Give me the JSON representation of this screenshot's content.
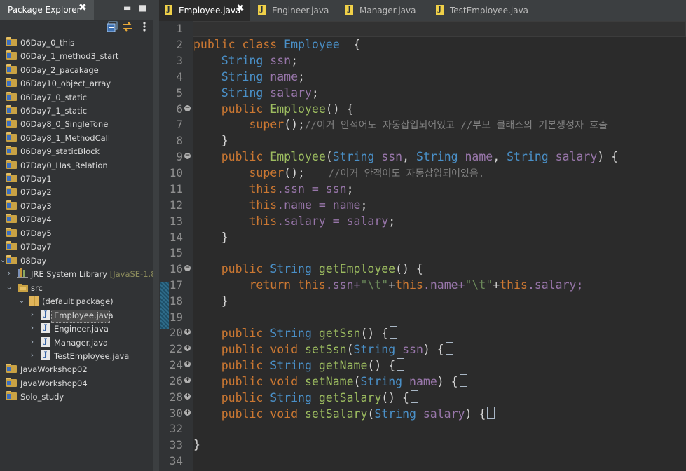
{
  "explorer": {
    "title": "Package Explorer",
    "close_glyph": "✖",
    "minimize_glyph": "▬",
    "maximize_glyph": "■",
    "toolbar_icons": [
      "collapse-all-icon",
      "link-with-editor-icon",
      "view-menu-icon"
    ],
    "tree": [
      {
        "label": "06Day_0_this",
        "kind": "project"
      },
      {
        "label": "06Day_1_method3_start",
        "kind": "project"
      },
      {
        "label": "06Day_2_pacakage",
        "kind": "project"
      },
      {
        "label": "06Day10_object_array",
        "kind": "project"
      },
      {
        "label": "06Day7_0_static",
        "kind": "project"
      },
      {
        "label": "06Day7_1_static",
        "kind": "project"
      },
      {
        "label": "06Day8_0_SingleTone",
        "kind": "project"
      },
      {
        "label": "06Day8_1_MethodCall",
        "kind": "project"
      },
      {
        "label": "06Day9_staticBlock",
        "kind": "project"
      },
      {
        "label": "07Day0_Has_Relation",
        "kind": "project"
      },
      {
        "label": "07Day1",
        "kind": "project"
      },
      {
        "label": "07Day2",
        "kind": "project"
      },
      {
        "label": "07Day3",
        "kind": "project"
      },
      {
        "label": "07Day4",
        "kind": "project"
      },
      {
        "label": "07Day5",
        "kind": "project"
      },
      {
        "label": "07Day7",
        "kind": "project"
      },
      {
        "label": "08Day",
        "kind": "project-open"
      },
      {
        "label": "JRE System Library",
        "suffix": "[JavaSE-1.8]",
        "kind": "library"
      },
      {
        "label": "src",
        "kind": "src"
      },
      {
        "label": "(default package)",
        "kind": "package"
      },
      {
        "label": "Employee.java",
        "kind": "java",
        "selected": true
      },
      {
        "label": "Engineer.java",
        "kind": "java"
      },
      {
        "label": "Manager.java",
        "kind": "java"
      },
      {
        "label": "TestEmployee.java",
        "kind": "java"
      },
      {
        "label": "JavaWorkshop02",
        "kind": "project"
      },
      {
        "label": "JavaWorkshop04",
        "kind": "project"
      },
      {
        "label": "Solo_study",
        "kind": "project"
      }
    ]
  },
  "editor": {
    "tabs": [
      {
        "label": "Employee.java",
        "active": true,
        "close": "✖"
      },
      {
        "label": "Engineer.java",
        "active": false
      },
      {
        "label": "Manager.java",
        "active": false
      },
      {
        "label": "TestEmployee.java",
        "active": false
      }
    ],
    "line_numbers": [
      "1",
      "2",
      "3",
      "4",
      "5",
      "6",
      "7",
      "8",
      "9",
      "10",
      "11",
      "12",
      "13",
      "14",
      "15",
      "16",
      "17",
      "18",
      "19",
      "20",
      "22",
      "24",
      "26",
      "28",
      "30",
      "32",
      "33",
      "34"
    ],
    "fold_markers": {
      "6": "−",
      "9": "−",
      "16": "−",
      "20": "+",
      "22": "+",
      "24": "+",
      "26": "+",
      "28": "+",
      "30": "+"
    },
    "code": {
      "l2": [
        "public",
        "class",
        "Employee",
        "  {"
      ],
      "l3": [
        "String",
        "ssn",
        ";"
      ],
      "l4": [
        "String",
        "name",
        ";"
      ],
      "l5": [
        "String",
        "salary",
        ";"
      ],
      "l6": [
        "public",
        "Employee",
        "() {"
      ],
      "l7": [
        "super",
        "();",
        "//이거 안적어도 자동삽입되어있고 //부모 클래스의 기본생성자 호출"
      ],
      "l8": [
        "}"
      ],
      "l9": [
        "public",
        "Employee",
        "(",
        "String",
        "ssn",
        ", ",
        "String",
        "name",
        ", ",
        "String",
        "salary",
        ") {"
      ],
      "l10": [
        "super",
        "();",
        "    //이거 안적어도 자동삽입되어있음."
      ],
      "l11": [
        "this",
        ".ssn = ",
        "ssn",
        ";"
      ],
      "l12": [
        "this",
        ".name = ",
        "name",
        ";"
      ],
      "l13": [
        "this",
        ".salary = ",
        "salary",
        ";"
      ],
      "l14": [
        "}"
      ],
      "l16": [
        "public",
        "String",
        "getEmployee",
        "() {"
      ],
      "l17": [
        "return",
        "this",
        ".ssn+",
        "\"\\t\"",
        "+",
        "this",
        ".name+",
        "\"\\t\"",
        "+",
        "this",
        ".salary;"
      ],
      "l18": [
        "}"
      ],
      "l20": [
        "public",
        "String",
        "getSsn",
        "() {"
      ],
      "l22": [
        "public",
        "void",
        "setSsn",
        "(",
        "String",
        "ssn",
        ") {"
      ],
      "l24": [
        "public",
        "String",
        "getName",
        "() {"
      ],
      "l26": [
        "public",
        "void",
        "setName",
        "(",
        "String",
        "name",
        ") {"
      ],
      "l28": [
        "public",
        "String",
        "getSalary",
        "() {"
      ],
      "l30": [
        "public",
        "void",
        "setSalary",
        "(",
        "String",
        "salary",
        ") {"
      ],
      "l33": [
        "}"
      ]
    }
  },
  "colors": {
    "keyword": "#cc7832",
    "type": "#4a90c8",
    "method": "#9dbd60",
    "field": "#9876aa",
    "string": "#6a8759",
    "comment": "#808080"
  }
}
